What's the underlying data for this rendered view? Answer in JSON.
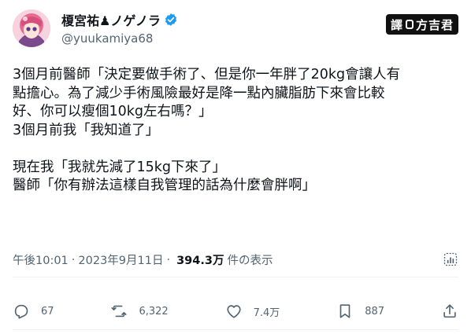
{
  "author": {
    "display_name": "榎宮祐♟ノゲノラ",
    "handle": "@yuukamiya68"
  },
  "watermark": {
    "left": "譯",
    "right": "方吉君"
  },
  "tweet": {
    "lines": [
      "3個月前醫師「決定要做手術了、但是你一年胖了20kg會讓人有",
      "點擔心。為了減少手術風險最好是降一點內臟脂肪下來會比較",
      "好、你可以瘦個10kg左右嗎？」",
      "3個月前我「我知道了」",
      "",
      "現在我「我就先減了15kg下來了」",
      "醫師「你有辦法這樣自我管理的話為什麼會胖啊」"
    ]
  },
  "meta": {
    "time": "午後10:01",
    "separator": "·",
    "date": "2023年9月11日",
    "views": "394.3万",
    "views_label": "件の表示"
  },
  "actions": {
    "replies": "67",
    "retweets": "6,322",
    "likes": "7.4万",
    "bookmarks": "887"
  }
}
